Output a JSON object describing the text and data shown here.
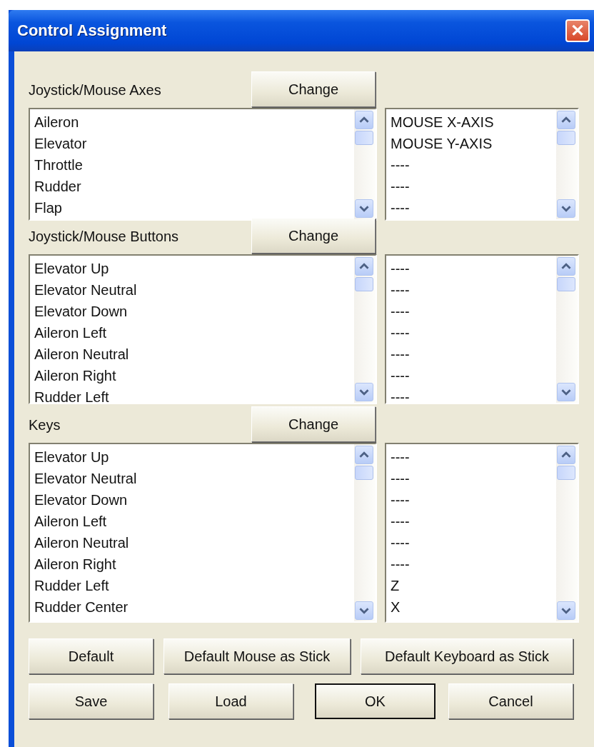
{
  "window": {
    "title": "Control Assignment",
    "close": "✕"
  },
  "sections": [
    {
      "label": "Joystick/Mouse Axes",
      "button": "Change",
      "actions": [
        "Aileron",
        "Elevator",
        "Throttle",
        "Rudder",
        "Flap"
      ],
      "bindings": [
        "MOUSE X-AXIS",
        "MOUSE Y-AXIS",
        "----",
        "----",
        "----"
      ]
    },
    {
      "label": "Joystick/Mouse Buttons",
      "button": "Change",
      "actions": [
        "Elevator Up",
        "Elevator Neutral",
        "Elevator Down",
        "Aileron Left",
        "Aileron Neutral",
        "Aileron Right",
        "Rudder Left"
      ],
      "bindings": [
        "----",
        "----",
        "----",
        "----",
        "----",
        "----",
        "----"
      ]
    },
    {
      "label": "Keys",
      "button": "Change",
      "actions": [
        "Elevator Up",
        "Elevator Neutral",
        "Elevator Down",
        "Aileron Left",
        "Aileron Neutral",
        "Aileron Right",
        "Rudder Left",
        "Rudder Center"
      ],
      "bindings": [
        "----",
        "----",
        "----",
        "----",
        "----",
        "----",
        "Z",
        "X"
      ]
    }
  ],
  "preset_buttons": [
    "Default",
    "Default Mouse as Stick",
    "Default Keyboard as Stick"
  ],
  "dialog_buttons": [
    {
      "label": "Save",
      "default": false
    },
    {
      "label": "Load",
      "default": false
    },
    {
      "label": "OK",
      "default": true
    },
    {
      "label": "Cancel",
      "default": false
    }
  ]
}
